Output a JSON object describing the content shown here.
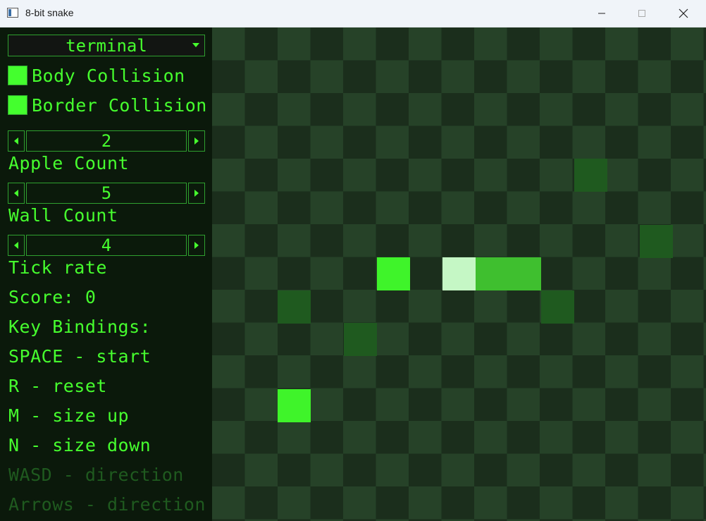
{
  "window": {
    "title": "8-bit snake"
  },
  "sidebar": {
    "theme_dropdown": {
      "value": "terminal"
    },
    "checkboxes": [
      {
        "label": "Body Collision",
        "checked": true
      },
      {
        "label": "Border Collision",
        "checked": true
      }
    ],
    "spinners": [
      {
        "value": "2",
        "label": "Apple Count"
      },
      {
        "value": "5",
        "label": "Wall Count"
      },
      {
        "value": "4",
        "label": "Tick rate"
      }
    ],
    "score": "Score: 0",
    "key_bindings_heading": "Key Bindings:",
    "bindings": [
      "SPACE - start",
      "R - reset",
      "M - size up",
      "N - size down",
      "WASD - direction",
      "Arrows - direction"
    ]
  },
  "colors": {
    "accent": "#46ff2e",
    "border": "#2fa02f",
    "apple": "#3ff42a",
    "snake_head": "#c5f7c5",
    "snake_body": "#3fbf2f",
    "wall": "#1f5a1f",
    "board_dark": "#1b2e1c",
    "board_light": "#264228"
  },
  "board": {
    "grid": {
      "cols": 15,
      "rows": 15
    },
    "apples": [
      [
        5,
        7
      ],
      [
        2,
        11
      ]
    ],
    "snake_head": [
      7,
      7
    ],
    "snake_body": [
      [
        8,
        7
      ],
      [
        9,
        7
      ]
    ],
    "walls": [
      [
        11,
        4
      ],
      [
        13,
        6
      ],
      [
        2,
        8
      ],
      [
        10,
        8
      ],
      [
        4,
        9
      ]
    ]
  }
}
